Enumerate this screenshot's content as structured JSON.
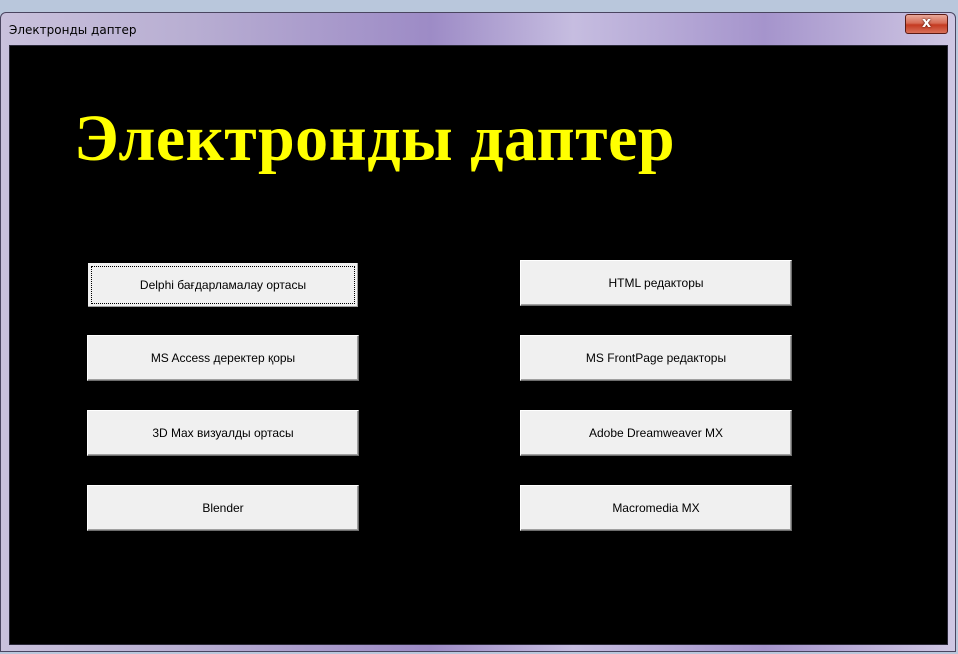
{
  "window": {
    "title": "Электронды даптер",
    "close_label": "x"
  },
  "main": {
    "heading": "Электронды даптер",
    "buttons_left": [
      {
        "label": "Delphi бағдарламалау ортасы"
      },
      {
        "label": "MS Access деректер қоры"
      },
      {
        "label": "3D Max визуалды ортасы"
      },
      {
        "label": "Blender"
      }
    ],
    "buttons_right": [
      {
        "label": "HTML редакторы"
      },
      {
        "label": "MS FrontPage редакторы"
      },
      {
        "label": "Adobe Dreamweaver MX"
      },
      {
        "label": "Macromedia MX"
      }
    ]
  },
  "colors": {
    "background": "#000000",
    "heading": "#ffff00",
    "button_face": "#f0f0f0"
  }
}
